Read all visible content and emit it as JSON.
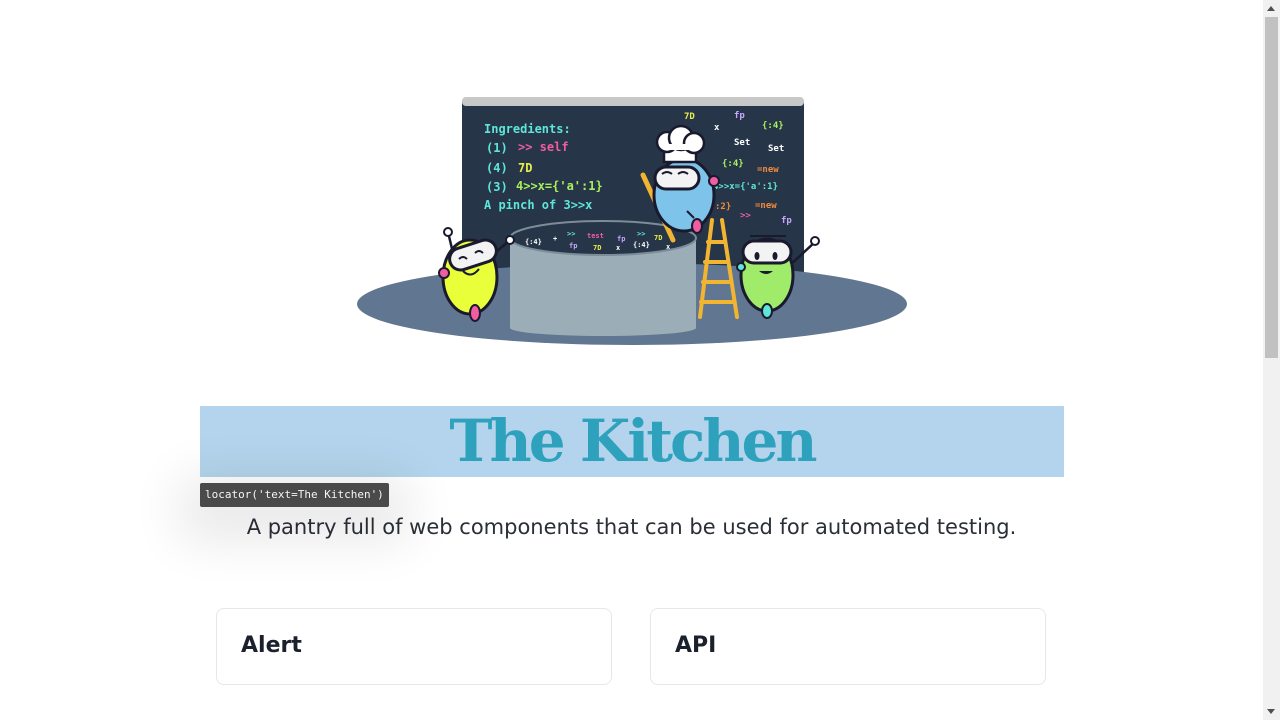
{
  "hero": {
    "recipe": {
      "heading": "Ingredients:",
      "line1_num": "(1)",
      "line1_text": ">> self",
      "line2_num": "(4)",
      "line2_text": "7D",
      "line3_num": "(3)",
      "line3_text": "4>>x={'a':1}",
      "line4": "A pinch of 3>>x"
    },
    "symbols": [
      "7D",
      "fp",
      "x",
      "{:4}",
      "Set",
      "Set",
      "{:4}",
      "=new",
      "4>>x={'a':1}",
      ":2}",
      "=new",
      ">>",
      "fp"
    ],
    "pot_symbols": [
      "{:4}",
      "+",
      ">>",
      "test",
      "fp",
      ">>",
      "7D",
      "fp",
      "7D",
      "x",
      "{:4}",
      "x"
    ]
  },
  "title": "The Kitchen",
  "tooltip": "locator('text=The Kitchen')",
  "subtitle": "A pantry full of web components that can be used for automated testing.",
  "cards": [
    {
      "label": "Alert"
    },
    {
      "label": "API"
    }
  ],
  "colors": {
    "title": "#2ea2bd",
    "title_band": "#b3d4ec",
    "chalkboard": "#263548",
    "platform": "#617690",
    "pot": "#9badb7"
  }
}
